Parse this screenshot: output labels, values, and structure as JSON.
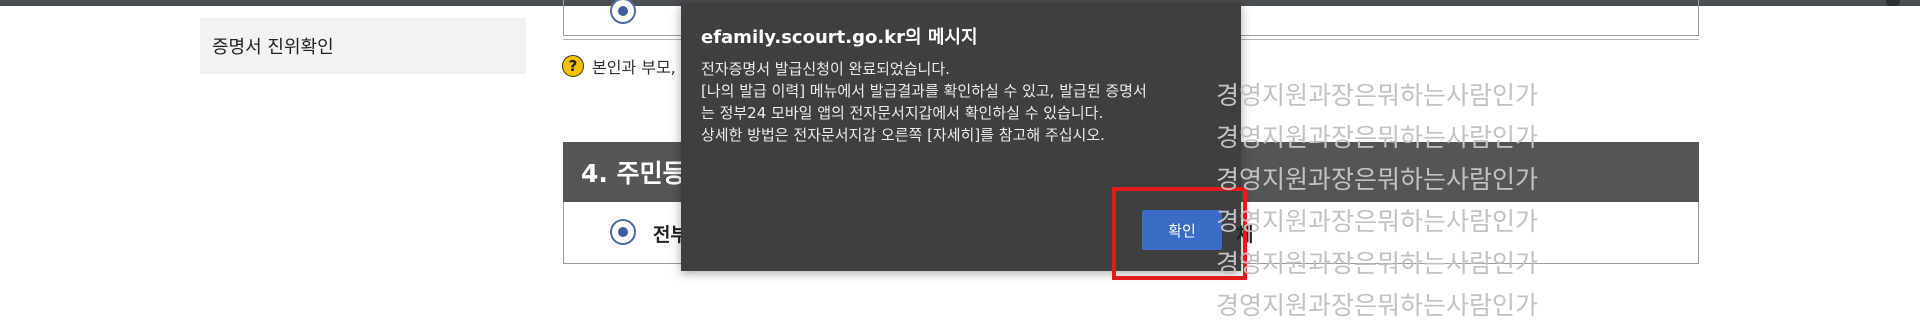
{
  "sidebar": {
    "item_label": "증명서 진위확인"
  },
  "help": {
    "text": "본인과 부모,"
  },
  "section": {
    "title": "4. 주민등",
    "option_label": "전부",
    "option_suffix": "체"
  },
  "watermark": {
    "lines": [
      "경영지원과장은뭐하는사람인가",
      "경영지원과장은뭐하는사람인가",
      "경영지원과장은뭐하는사람인가",
      "경영지원과장은뭐하는사람인가",
      "경영지원과장은뭐하는사람인가",
      "경영지원과장은뭐하는사람인가"
    ]
  },
  "dialog": {
    "title": "efamily.scourt.go.kr의 메시지",
    "lines": [
      "전자증명서 발급신청이 완료되었습니다.",
      "[나의 발급 이력] 메뉴에서 발급결과를 확인하실 수 있고, 발급된 증명서",
      "는 정부24 모바일 앱의 전자문서지갑에서 확인하실 수 있습니다.",
      "상세한 방법은 전자문서지갑 오른쪽 [자세히]를 참고해 주십시오."
    ],
    "ok_label": "확인"
  },
  "colors": {
    "highlight": "#e21b1b",
    "button": "#3a6cc6",
    "dialog_bg": "#3f3f3f"
  }
}
